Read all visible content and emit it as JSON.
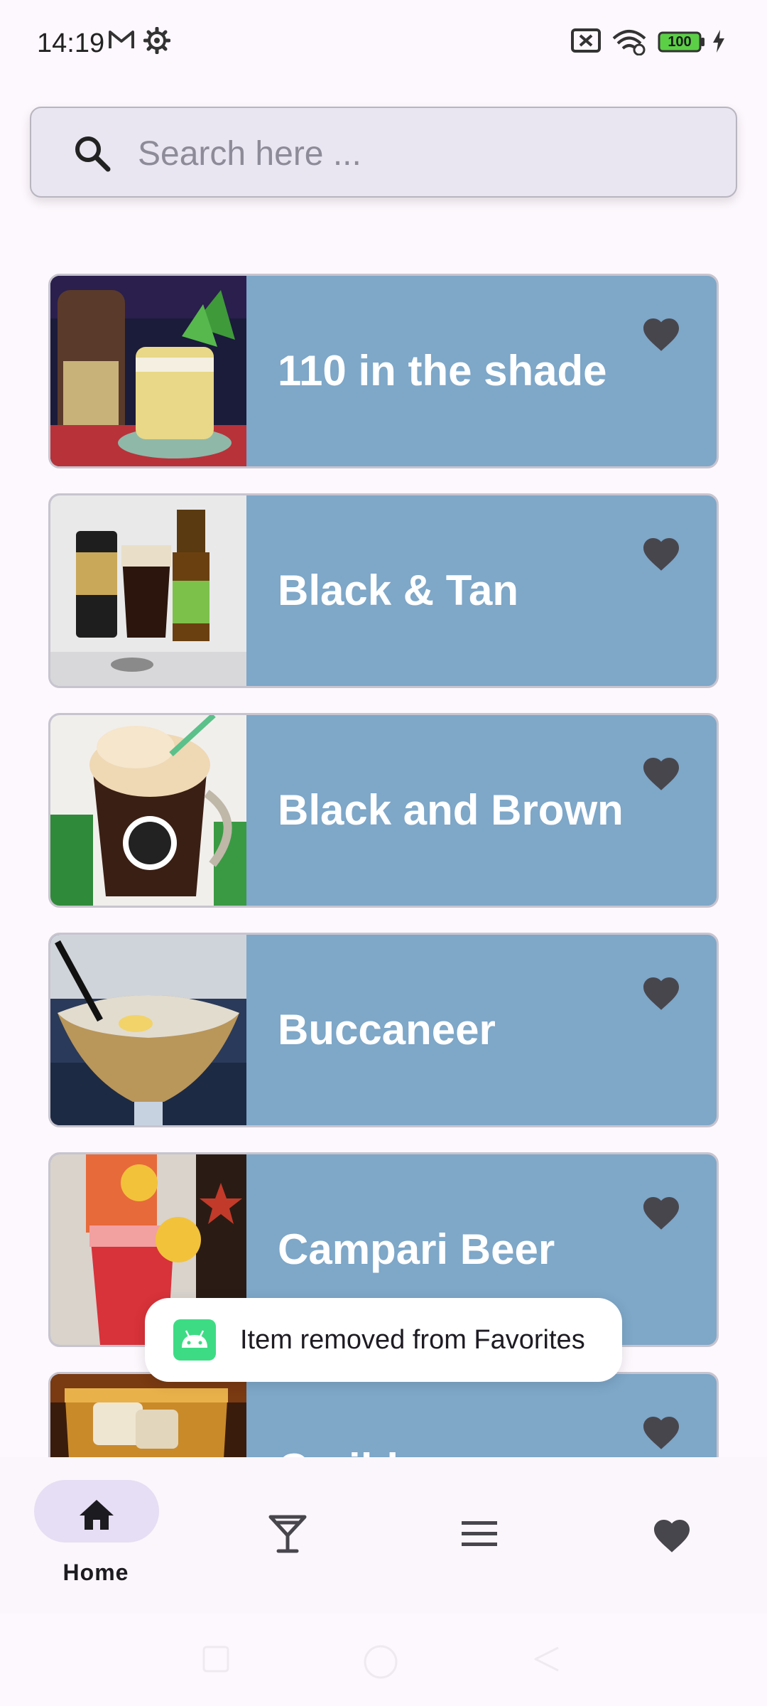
{
  "status_bar": {
    "time": "14:19",
    "battery": "100",
    "icons": [
      "gmail-icon",
      "settings-icon",
      "no-sim-icon",
      "wifi-icon",
      "battery-icon",
      "charging-icon"
    ]
  },
  "search": {
    "placeholder": "Search here ...",
    "value": ""
  },
  "drinks": [
    {
      "name": "110 in the shade",
      "favorite": true,
      "thumb": "cocktail-photo"
    },
    {
      "name": "Black & Tan",
      "favorite": true,
      "thumb": "beer-cans-photo"
    },
    {
      "name": "Black and Brown",
      "favorite": true,
      "thumb": "root-beer-float-photo"
    },
    {
      "name": "Buccaneer",
      "favorite": true,
      "thumb": "cocktail-glass-photo"
    },
    {
      "name": "Campari Beer",
      "favorite": true,
      "thumb": "campari-photo"
    },
    {
      "name": "Caribbean",
      "favorite": true,
      "thumb": "whiskey-photo"
    }
  ],
  "toast": {
    "message": "Item removed from Favorites",
    "icon": "android-icon"
  },
  "bottom_nav": {
    "items": [
      {
        "label": "Home",
        "icon": "home-icon",
        "active": true
      },
      {
        "label": "",
        "icon": "cocktail-icon",
        "active": false
      },
      {
        "label": "",
        "icon": "menu-icon",
        "active": false
      },
      {
        "label": "",
        "icon": "heart-icon",
        "active": false
      }
    ]
  },
  "colors": {
    "card_bg": "#7ea7c8",
    "active_pill": "#e6def4",
    "search_bg": "#e9e5f1",
    "heart": "#48464d"
  }
}
